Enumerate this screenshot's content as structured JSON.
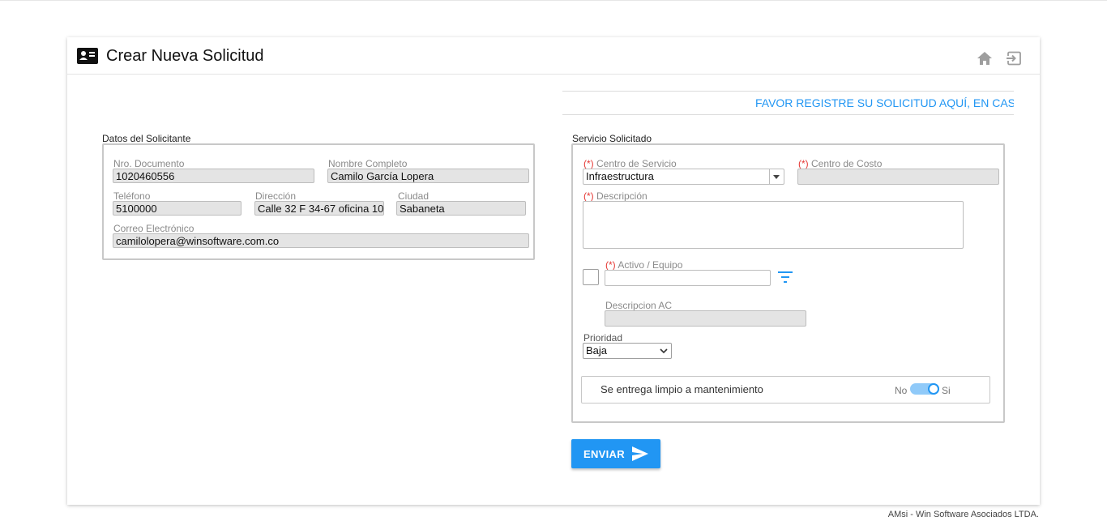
{
  "header": {
    "title": "Crear Nueva Solicitud",
    "icons": [
      "contact-card-icon",
      "home-icon",
      "exit-icon"
    ]
  },
  "banner": {
    "text": "FAVOR REGISTRE SU SOLICITUD AQUÍ, EN CASO DE"
  },
  "solicitante": {
    "section_label": "Datos del Solicitante",
    "documento_label": "Nro. Documento",
    "documento_value": "1020460556",
    "nombre_label": "Nombre Completo",
    "nombre_value": "Camilo García Lopera",
    "telefono_label": "Teléfono",
    "telefono_value": "5100000",
    "direccion_label": "Dirección",
    "direccion_value": "Calle 32 F 34-67 oficina 10",
    "ciudad_label": "Ciudad",
    "ciudad_value": "Sabaneta",
    "correo_label": "Correo Electrónico",
    "correo_value": "camilolopera@winsoftware.com.co"
  },
  "servicio": {
    "section_label": "Servicio Solicitado",
    "required_mark": "(*)",
    "centro_servicio_label": " Centro de Servicio",
    "centro_servicio_value": "Infraestructura",
    "centro_costo_label": " Centro de Costo",
    "descripcion_label": " Descripción",
    "activo_label": " Activo / Equipo",
    "descripcion_ac_label": "Descripcion AC",
    "prioridad_label": "Prioridad",
    "prioridad_value": "Baja",
    "toggle_label": "Se entrega limpio a mantenimiento",
    "toggle_off": "No",
    "toggle_on": "Si",
    "toggle_state": "Si"
  },
  "actions": {
    "enviar_label": "ENVIAR"
  },
  "footer": {
    "text": "AMsi - Win Software Asociados LTDA."
  },
  "colors": {
    "accent": "#2196f3",
    "required": "#e53935",
    "readonly_bg": "#e4e4e4"
  }
}
